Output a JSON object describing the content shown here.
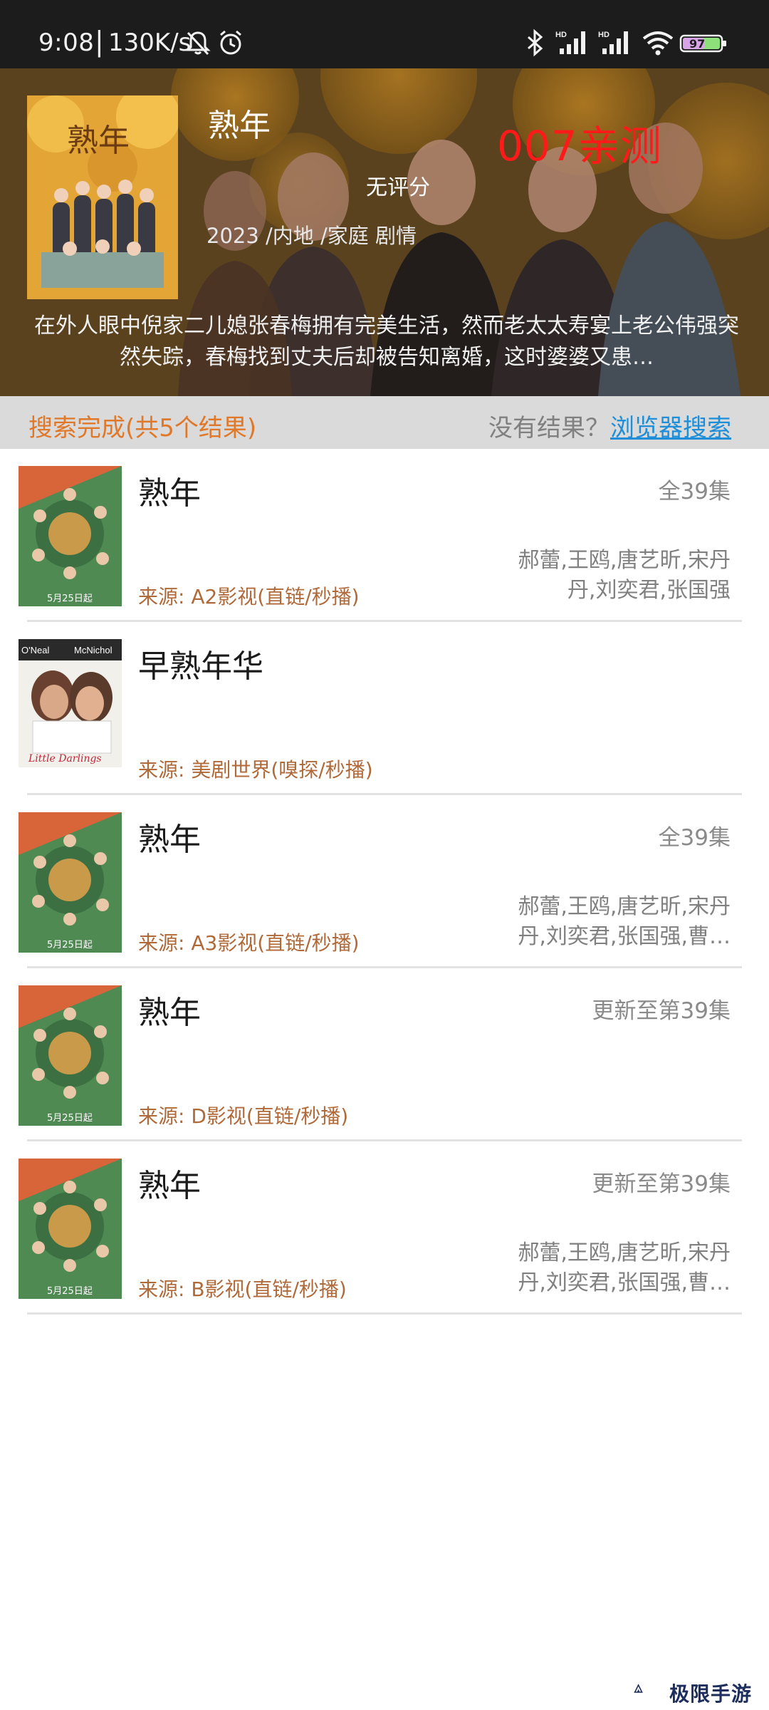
{
  "status_bar": {
    "time": "9:08",
    "separator": "|",
    "net_speed": "130K/s",
    "battery": "97",
    "icons": [
      "silent-bell-icon",
      "alarm-icon",
      "bluetooth-icon",
      "hd-signal-icon",
      "hd-signal-icon",
      "wifi-icon",
      "battery-icon"
    ]
  },
  "hero": {
    "title": "熟年",
    "tag": "007亲测",
    "rating": "无评分",
    "meta": "2023 /内地 /家庭 剧情",
    "description": "在外人眼中倪家二儿媳张春梅拥有完美生活，然而老太太寿宴上老公伟强突然失踪，春梅找到丈夫后却被告知离婚，这时婆婆又患…",
    "poster_text": "熟年"
  },
  "search": {
    "status": "搜索完成(共5个结果)",
    "no_result_prompt": "没有结果？",
    "browser_search": "浏览器搜索"
  },
  "results": [
    {
      "title": "熟年",
      "episodes": "全39集",
      "cast": "郝蕾,王鸥,唐艺昕,宋丹丹,刘奕君,张国强",
      "source": "来源: A2影视(直链/秒播)",
      "poster_caption": "5月25日起"
    },
    {
      "title": "早熟年华",
      "episodes": "",
      "cast": "",
      "source": "来源: 美剧世界(嗅探/秒播)",
      "poster_top_left": "O'Neal",
      "poster_top_right": "McNichol",
      "poster_caption": "Little Darlings"
    },
    {
      "title": "熟年",
      "episodes": "全39集",
      "cast": "郝蕾,王鸥,唐艺昕,宋丹丹,刘奕君,张国强,曹…",
      "source": "来源: A3影视(直链/秒播)",
      "poster_caption": "5月25日起"
    },
    {
      "title": "熟年",
      "episodes": "更新至第39集",
      "cast": "",
      "source": "来源: D影视(直链/秒播)",
      "poster_caption": "5月25日起"
    },
    {
      "title": "熟年",
      "episodes": "更新至第39集",
      "cast": "郝蕾,王鸥,唐艺昕,宋丹丹,刘奕君,张国强,曹…",
      "source": "来源: B影视(直链/秒播)",
      "poster_caption": "5月25日起"
    }
  ],
  "watermark": {
    "text": "极限手游网"
  },
  "colors": {
    "accent_orange": "#e0782a",
    "link_blue": "#1e8ed8",
    "source_brown": "#b06a3a",
    "tag_red": "#ff1a1a"
  }
}
